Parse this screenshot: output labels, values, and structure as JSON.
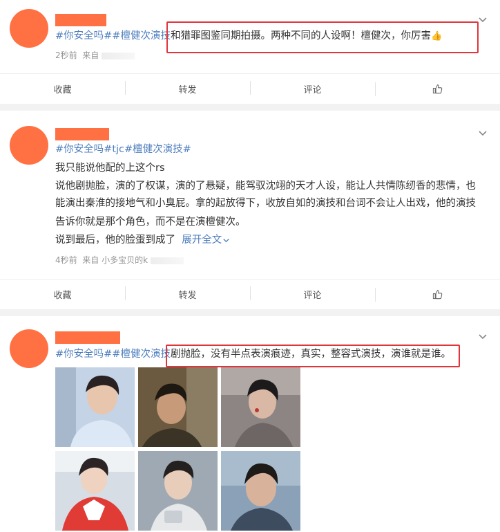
{
  "actions": {
    "favorite": "收藏",
    "repost": "转发",
    "comment": "评论"
  },
  "post1": {
    "tags": "#你安全吗##檀健次演技",
    "text": "和猎罪图鉴同期拍摄。两种不同的人设啊！檀健次，你厉害",
    "emoji": "👍",
    "time": "2秒前",
    "source_prefix": "来自"
  },
  "post2": {
    "tags_prefix": "#你安全吗#",
    "tags_mid": "tjc",
    "tags_suffix": "#檀健次演技#",
    "line1": "我只能说他配的上这个rs",
    "line2": "说他剧抛脸，演的了权谋，演的了悬疑，能驾驭沈翊的天才人设，能让人共情陈纫香的悲情，也",
    "line3": "能演出秦淮的接地气和小臭屁。拿的起放得下，收放自如的演技和台词不会让人出戏，他的演技",
    "line4": "告诉你就是那个角色，而不是在演檀健次。",
    "line5": "说到最后，他的脸蛋到成了",
    "more": "展开全文",
    "more_icon": "chevron-down",
    "time": "4秒前",
    "source": "来自 小多宝贝的k"
  },
  "post3": {
    "tags": "#你安全吗##檀健次演技",
    "text": "剧抛脸，没有半点表演痕迹，真实，整容式演技，演谁就是谁。"
  },
  "colors": {
    "accent": "#ff7043",
    "link": "#4f7fbf",
    "highlight": "#e0353b"
  }
}
